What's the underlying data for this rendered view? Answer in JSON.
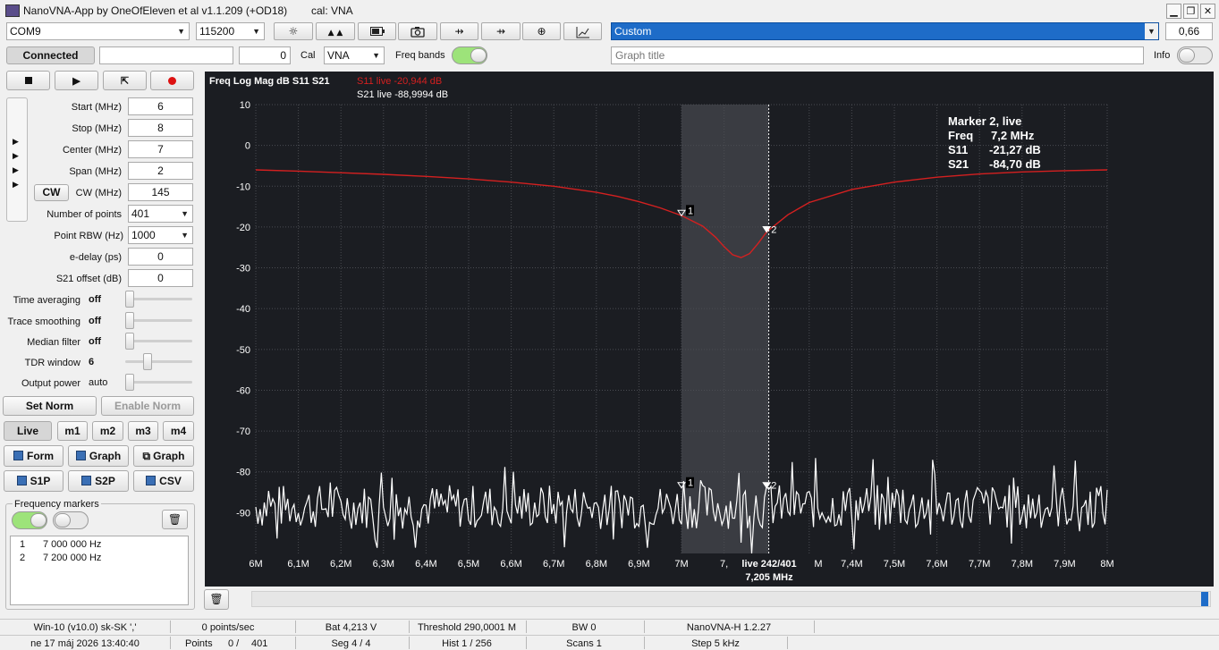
{
  "window": {
    "title": "NanoVNA-App by OneOfEleven et al v1.1.209 (+OD18)",
    "cal": "cal: VNA",
    "minimize": "▁",
    "restore": "❐",
    "close": "✕"
  },
  "toolbar": {
    "port": "COM9",
    "baud": "115200",
    "preset": "Custom",
    "scale_value": "0,66",
    "icons": [
      "settings-icon",
      "up-arrows-icon",
      "battery-icon",
      "camera-icon",
      "usb-icon",
      "usb-alt-icon",
      "crosshair-icon",
      "graph-icon"
    ]
  },
  "row2": {
    "connected_label": "Connected",
    "field_text": "",
    "field_num": "0",
    "cal_label": "Cal",
    "cal_value": "VNA",
    "freq_bands_label": "Freq bands",
    "graph_title_placeholder": "Graph title",
    "info_label": "Info"
  },
  "controls": {
    "start_label": "Start (MHz)",
    "start": "6",
    "stop_label": "Stop (MHz)",
    "stop": "8",
    "center_label": "Center (MHz)",
    "center": "7",
    "span_label": "Span (MHz)",
    "span": "2",
    "cw_button": "CW",
    "cw_label": "CW (MHz)",
    "cw": "145",
    "points_label": "Number of points",
    "points": "401",
    "rbw_label": "Point RBW (Hz)",
    "rbw": "1000",
    "edelay_label": "e-delay (ps)",
    "edelay": "0",
    "s21off_label": "S21 offset (dB)",
    "s21off": "0",
    "time_avg_label": "Time averaging",
    "time_avg": "off",
    "trace_smooth_label": "Trace smoothing",
    "trace_smooth": "off",
    "median_label": "Median filter",
    "median": "off",
    "tdr_label": "TDR window",
    "tdr": "6",
    "power_label": "Output power",
    "power": "auto",
    "set_norm": "Set Norm",
    "enable_norm": "Enable Norm",
    "live": "Live",
    "m1": "m1",
    "m2": "m2",
    "m3": "m3",
    "m4": "m4",
    "form": "Form",
    "graph1": "Graph",
    "graph2": "Graph",
    "s1p": "S1P",
    "s2p": "S2P",
    "csv": "CSV",
    "freq_markers_label": "Frequency markers",
    "markers": [
      {
        "n": "1",
        "freq": "7 000 000 Hz"
      },
      {
        "n": "2",
        "freq": "7 200 000 Hz"
      }
    ]
  },
  "chart_data": {
    "type": "line",
    "title": "Freq Log Mag dB S11 S21",
    "legend_s11": "S11 live -20,944 dB",
    "legend_s21": "S21 live -88,9994 dB",
    "x_unit": "MHz",
    "xlim": [
      6,
      8
    ],
    "ylim": [
      -100,
      10
    ],
    "x_ticks": [
      "6M",
      "6,1M",
      "6,2M",
      "6,3M",
      "6,4M",
      "6,5M",
      "6,6M",
      "6,7M",
      "6,8M",
      "6,9M",
      "7M",
      "7,",
      "",
      "",
      "7,4M",
      "7,5M",
      "7,6M",
      "7,7M",
      "7,8M",
      "7,9M",
      "8M"
    ],
    "y_ticks": [
      "10",
      "0",
      "-10",
      "-20",
      "-30",
      "-40",
      "-50",
      "-60",
      "-70",
      "-80",
      "-90"
    ],
    "y_tick_values": [
      10,
      0,
      -10,
      -20,
      -30,
      -40,
      -50,
      -60,
      -70,
      -80,
      -90
    ],
    "highlight_band": [
      7.0,
      7.205
    ],
    "cursor_x": 7.205,
    "cursor_label_line1": "live 242/401",
    "cursor_label_line2": "7,205 MHz",
    "marker_box": {
      "title": "Marker 2, live",
      "freq_label": "Freq",
      "freq": "7,2 MHz",
      "s11_label": "S11",
      "s11": "-21,27 dB",
      "s21_label": "S21",
      "s21": "-84,70 dB"
    },
    "marker_labels": [
      "1",
      "2"
    ],
    "series": [
      {
        "name": "S11",
        "color": "#d42020",
        "x": [
          6.0,
          6.1,
          6.2,
          6.3,
          6.4,
          6.5,
          6.6,
          6.7,
          6.8,
          6.85,
          6.9,
          6.95,
          7.0,
          7.05,
          7.08,
          7.1,
          7.12,
          7.14,
          7.16,
          7.18,
          7.2,
          7.25,
          7.3,
          7.4,
          7.5,
          7.6,
          7.7,
          7.8,
          7.9,
          8.0
        ],
        "values": [
          -6.0,
          -6.3,
          -6.7,
          -7.1,
          -7.6,
          -8.2,
          -9.0,
          -10.0,
          -11.5,
          -12.5,
          -13.8,
          -15.3,
          -17.2,
          -19.8,
          -22.5,
          -24.8,
          -26.8,
          -27.5,
          -26.5,
          -24.0,
          -21.2,
          -17.0,
          -14.0,
          -10.8,
          -9.0,
          -7.8,
          -7.0,
          -6.5,
          -6.2,
          -6.0
        ]
      },
      {
        "name": "S21",
        "color": "#ffffff",
        "noise_mean": -88.5,
        "noise_span": 11,
        "points": 401
      }
    ]
  },
  "bottom": {
    "status1": [
      "Win-10 (v10.0) sk-SK ','",
      "0 points/sec",
      "Bat 4,213 V",
      "Threshold 290,0001 M",
      "BW 0",
      "NanoVNA-H 1.2.27"
    ],
    "status2": [
      "ne 17 máj 2026 13:40:40",
      "Points",
      "0 /",
      "401",
      "Seg 4 / 4",
      "Hist 1 / 256",
      "Scans 1",
      "Step 5 kHz"
    ]
  }
}
